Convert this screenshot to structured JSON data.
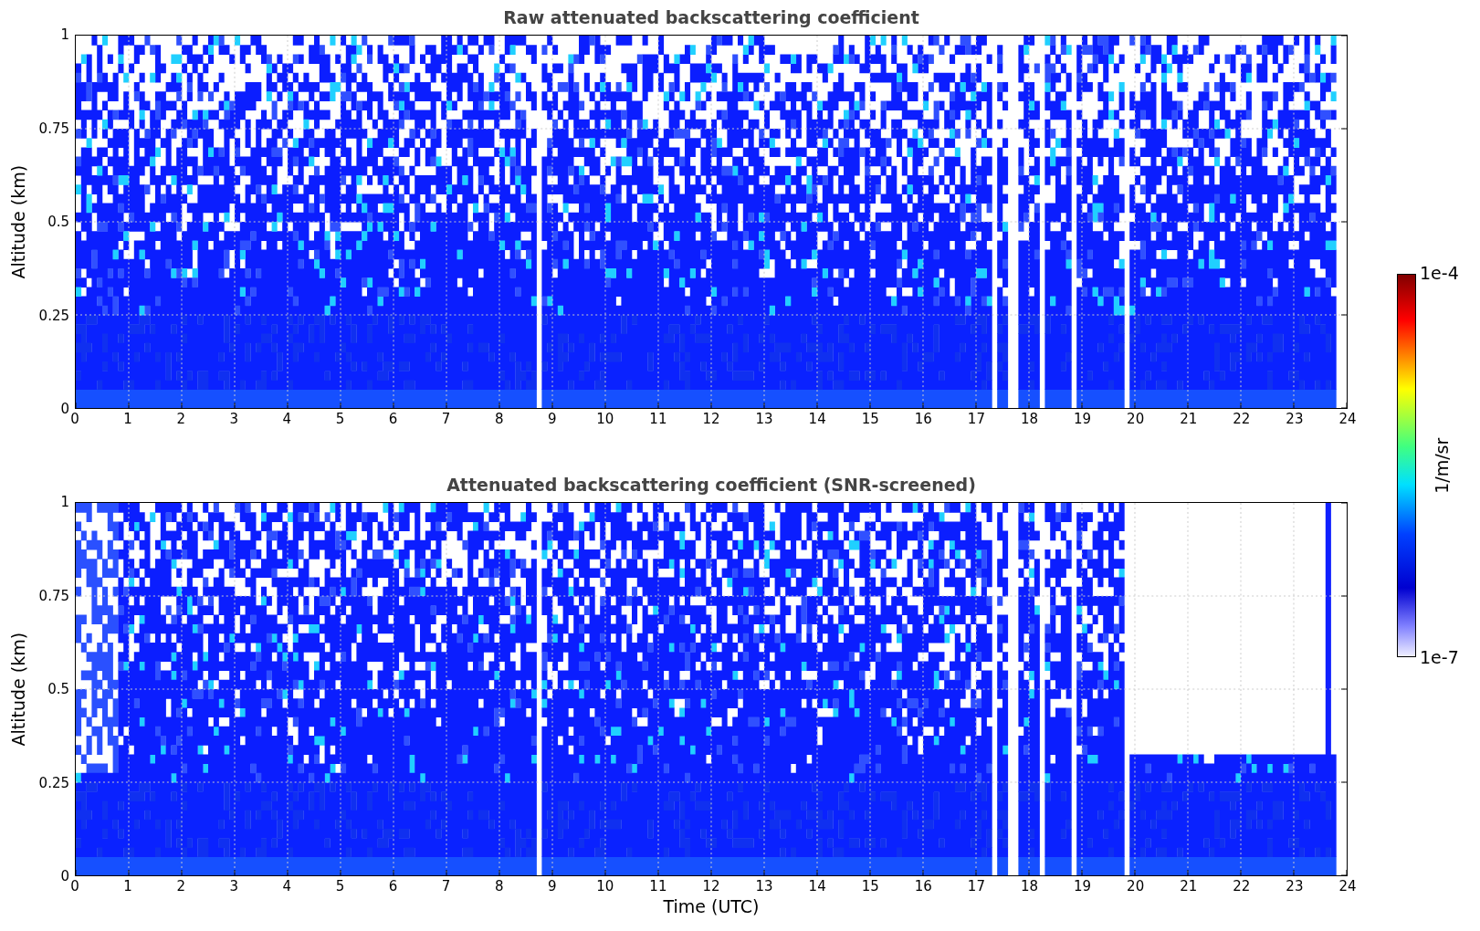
{
  "panels": [
    {
      "kind": "raw",
      "title": "Raw attenuated backscattering coefficient",
      "ylabel": "Altitude (km)",
      "yticks": [
        "1",
        "0.75",
        "0.5",
        "0.25",
        "0"
      ],
      "xticks": [
        "0",
        "1",
        "2",
        "3",
        "4",
        "5",
        "6",
        "7",
        "8",
        "9",
        "10",
        "11",
        "12",
        "13",
        "14",
        "15",
        "16",
        "17",
        "18",
        "19",
        "20",
        "21",
        "22",
        "23",
        "24"
      ]
    },
    {
      "kind": "screened",
      "title": "Attenuated backscattering coefficient (SNR-screened)",
      "ylabel": "Altitude (km)",
      "xlabel": "Time (UTC)",
      "yticks": [
        "1",
        "0.75",
        "0.5",
        "0.25",
        "0"
      ],
      "xticks": [
        "0",
        "1",
        "2",
        "3",
        "4",
        "5",
        "6",
        "7",
        "8",
        "9",
        "10",
        "11",
        "12",
        "13",
        "14",
        "15",
        "16",
        "17",
        "18",
        "19",
        "20",
        "21",
        "22",
        "23",
        "24"
      ]
    }
  ],
  "colorbar": {
    "max_label": "1e-4",
    "min_label": "1e-7",
    "unit": "1/m/sr"
  }
}
